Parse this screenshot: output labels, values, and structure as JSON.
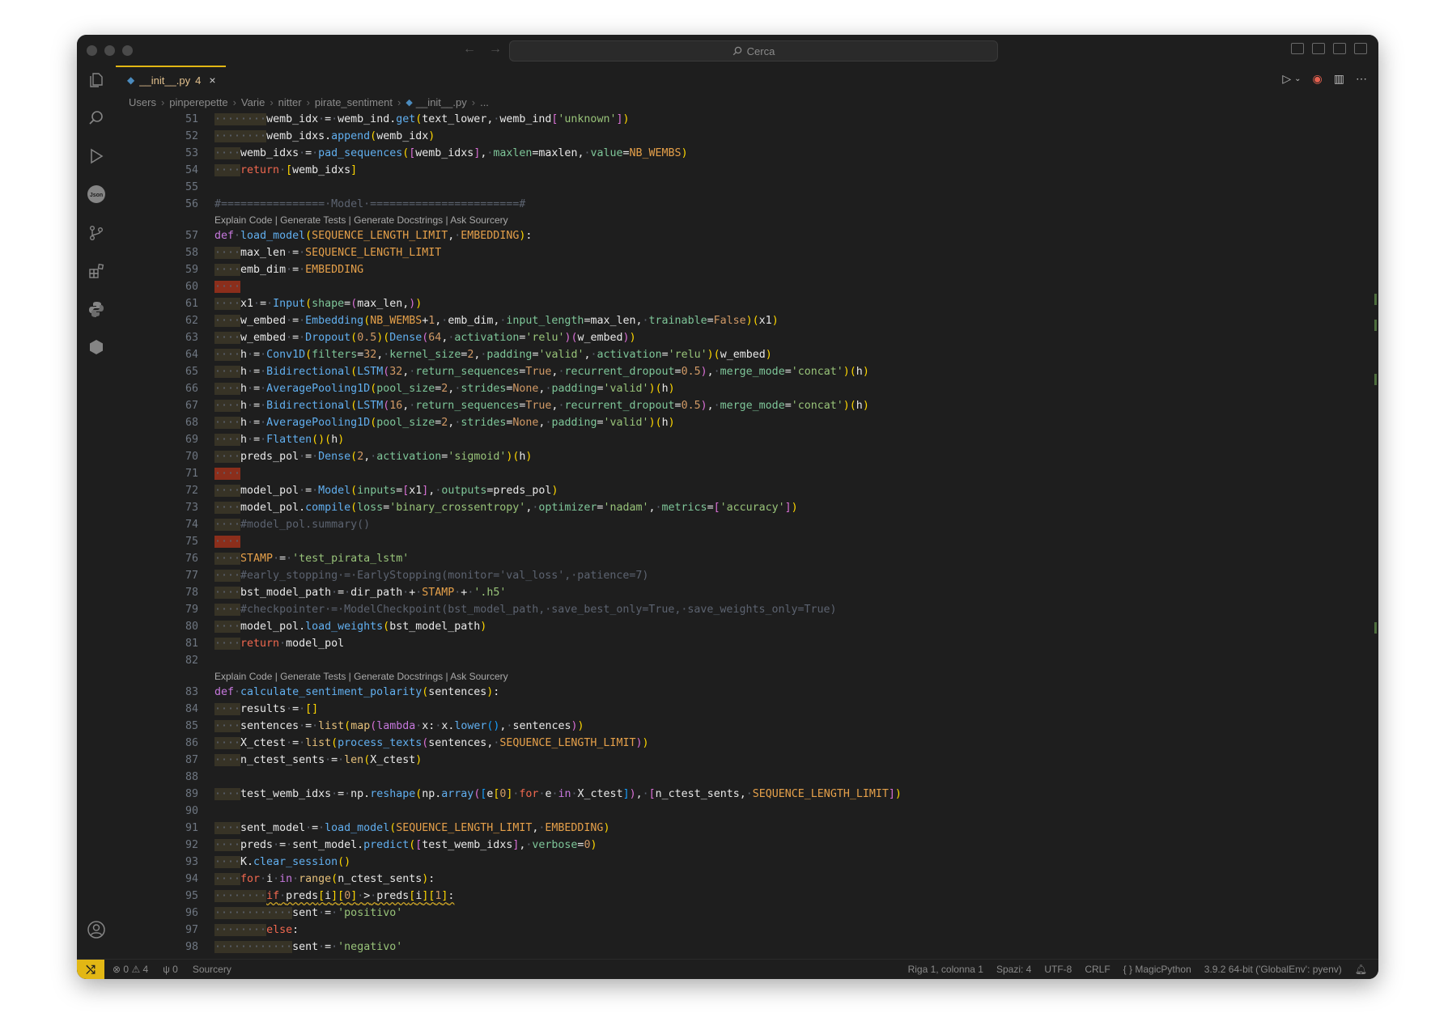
{
  "window": {
    "search_placeholder": "Cerca"
  },
  "tab": {
    "label": "__init__.py",
    "problems": "4",
    "close": "×"
  },
  "breadcrumb": [
    "Users",
    "pinperepette",
    "Varie",
    "nitter",
    "pirate_sentiment",
    "__init__.py",
    "..."
  ],
  "codelens": "Explain Code | Generate Tests | Generate Docstrings | Ask Sourcery",
  "status": {
    "errors": "0",
    "warnings": "4",
    "ports": "0",
    "sourcery": "Sourcery",
    "position": "Riga 1, colonna 1",
    "spaces": "Spazi: 4",
    "encoding": "UTF-8",
    "eol": "CRLF",
    "language": "MagicPython",
    "interpreter": "3.9.2 64-bit ('GlobalEnv': pyenv)"
  },
  "colors": {
    "accent": "#e2b714",
    "editor_bg": "#1e1e1e",
    "keyword": "#c678dd",
    "function": "#61afef",
    "string": "#98c379"
  },
  "icons": [
    "files-icon",
    "search-icon",
    "run-debug-icon",
    "json-icon",
    "source-control-icon",
    "extensions-icon",
    "python-icon",
    "hexagon-icon",
    "account-icon",
    "settings-gear-icon"
  ],
  "lines": [
    {
      "n": 51,
      "t": "        wemb_idx = wemb_ind.get(text_lower, wemb_ind['unknown'])"
    },
    {
      "n": 52,
      "t": "        wemb_idxs.append(wemb_idx)"
    },
    {
      "n": 53,
      "t": "    wemb_idxs = pad_sequences([wemb_idxs], maxlen=maxlen, value=NB_WEMBS)"
    },
    {
      "n": 54,
      "t": "    return [wemb_idxs]"
    },
    {
      "n": 55,
      "t": ""
    },
    {
      "n": 56,
      "t": "#================ Model =======================#"
    },
    {
      "n": 57,
      "t": "def load_model(SEQUENCE_LENGTH_LIMIT, EMBEDDING):"
    },
    {
      "n": 58,
      "t": "    max_len = SEQUENCE_LENGTH_LIMIT"
    },
    {
      "n": 59,
      "t": "    emb_dim = EMBEDDING"
    },
    {
      "n": 60,
      "t": "    "
    },
    {
      "n": 61,
      "t": "    x1 = Input(shape=(max_len,))"
    },
    {
      "n": 62,
      "t": "    w_embed = Embedding(NB_WEMBS+1, emb_dim, input_length=max_len, trainable=False)(x1)"
    },
    {
      "n": 63,
      "t": "    w_embed = Dropout(0.5)(Dense(64, activation='relu')(w_embed))"
    },
    {
      "n": 64,
      "t": "    h = Conv1D(filters=32, kernel_size=2, padding='valid', activation='relu')(w_embed)"
    },
    {
      "n": 65,
      "t": "    h = Bidirectional(LSTM(32, return_sequences=True, recurrent_dropout=0.5), merge_mode='concat')(h)"
    },
    {
      "n": 66,
      "t": "    h = AveragePooling1D(pool_size=2, strides=None, padding='valid')(h)"
    },
    {
      "n": 67,
      "t": "    h = Bidirectional(LSTM(16, return_sequences=True, recurrent_dropout=0.5), merge_mode='concat')(h)"
    },
    {
      "n": 68,
      "t": "    h = AveragePooling1D(pool_size=2, strides=None, padding='valid')(h)"
    },
    {
      "n": 69,
      "t": "    h = Flatten()(h)"
    },
    {
      "n": 70,
      "t": "    preds_pol = Dense(2, activation='sigmoid')(h)"
    },
    {
      "n": 71,
      "t": "    "
    },
    {
      "n": 72,
      "t": "    model_pol = Model(inputs=[x1], outputs=preds_pol)"
    },
    {
      "n": 73,
      "t": "    model_pol.compile(loss='binary_crossentropy', optimizer='nadam', metrics=['accuracy'])"
    },
    {
      "n": 74,
      "t": "    #model_pol.summary()"
    },
    {
      "n": 75,
      "t": "    "
    },
    {
      "n": 76,
      "t": "    STAMP = 'test_pirata_lstm'"
    },
    {
      "n": 77,
      "t": "    #early_stopping = EarlyStopping(monitor='val_loss', patience=7)"
    },
    {
      "n": 78,
      "t": "    bst_model_path = dir_path + STAMP + '.h5'"
    },
    {
      "n": 79,
      "t": "    #checkpointer = ModelCheckpoint(bst_model_path, save_best_only=True, save_weights_only=True)"
    },
    {
      "n": 80,
      "t": "    model_pol.load_weights(bst_model_path)"
    },
    {
      "n": 81,
      "t": "    return model_pol"
    },
    {
      "n": 82,
      "t": ""
    },
    {
      "n": 83,
      "t": "def calculate_sentiment_polarity(sentences):"
    },
    {
      "n": 84,
      "t": "    results = []"
    },
    {
      "n": 85,
      "t": "    sentences = list(map(lambda x: x.lower(), sentences))"
    },
    {
      "n": 86,
      "t": "    X_ctest = list(process_texts(sentences, SEQUENCE_LENGTH_LIMIT))"
    },
    {
      "n": 87,
      "t": "    n_ctest_sents = len(X_ctest)"
    },
    {
      "n": 88,
      "t": ""
    },
    {
      "n": 89,
      "t": "    test_wemb_idxs = np.reshape(np.array([e[0] for e in X_ctest]), [n_ctest_sents, SEQUENCE_LENGTH_LIMIT])"
    },
    {
      "n": 90,
      "t": ""
    },
    {
      "n": 91,
      "t": "    sent_model = load_model(SEQUENCE_LENGTH_LIMIT, EMBEDDING)"
    },
    {
      "n": 92,
      "t": "    preds = sent_model.predict([test_wemb_idxs], verbose=0)"
    },
    {
      "n": 93,
      "t": "    K.clear_session()"
    },
    {
      "n": 94,
      "t": "    for i in range(n_ctest_sents):"
    },
    {
      "n": 95,
      "t": "        if preds[i][0] > preds[i][1]:"
    },
    {
      "n": 96,
      "t": "            sent = 'positivo'"
    },
    {
      "n": 97,
      "t": "        else:"
    },
    {
      "n": 98,
      "t": "            sent = 'negativo'"
    }
  ]
}
